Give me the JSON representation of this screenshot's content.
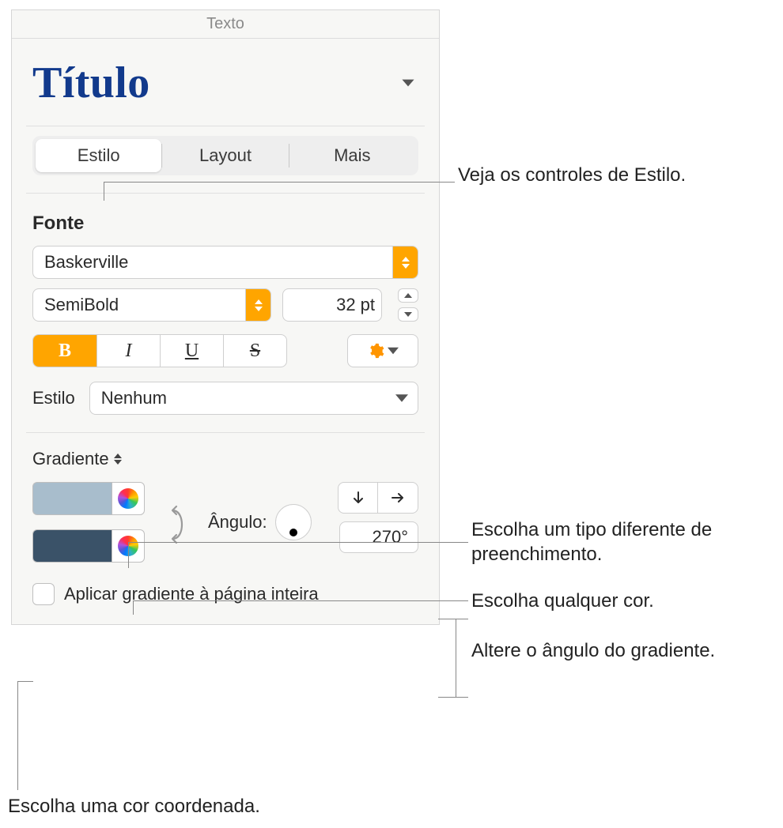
{
  "panel": {
    "title": "Texto",
    "paragraph_style_name": "Título"
  },
  "tabs": {
    "estilo": "Estilo",
    "layout": "Layout",
    "mais": "Mais"
  },
  "font": {
    "section_label": "Fonte",
    "family": "Baskerville",
    "style": "SemiBold",
    "size_value": "32",
    "size_unit": "pt",
    "bold_label": "B",
    "italic_label": "I",
    "underline_label": "U",
    "strike_label": "S",
    "char_style_label": "Estilo",
    "char_style_value": "Nenhum"
  },
  "fill": {
    "type_label": "Gradiente",
    "color1": "#a8bdcc",
    "color2": "#3a5268",
    "angle_label": "Ângulo:",
    "angle_value": "270°",
    "apply_page_label": "Aplicar gradiente à página inteira"
  },
  "callouts": {
    "c1": "Veja os controles de Estilo.",
    "c2": "Escolha um tipo diferente de preenchimento.",
    "c3": "Escolha qualquer cor.",
    "c4": "Altere o ângulo do gradiente.",
    "c5": "Escolha uma cor coordenada."
  }
}
